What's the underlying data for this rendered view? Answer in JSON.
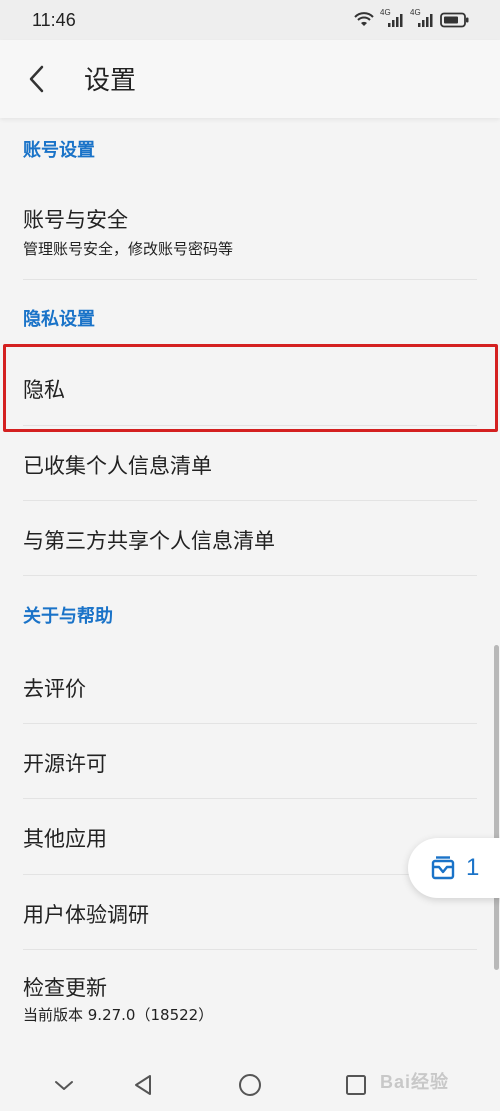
{
  "status_bar": {
    "time": "11:46",
    "signal_1_label": "4G",
    "signal_2_label": "4G"
  },
  "header": {
    "title": "设置"
  },
  "sections": {
    "account": {
      "header": "账号设置",
      "items": [
        {
          "title": "账号与安全",
          "subtitle": "管理账号安全，修改账号密码等"
        }
      ]
    },
    "privacy": {
      "header": "隐私设置",
      "items": [
        {
          "title": "隐私"
        },
        {
          "title": "已收集个人信息清单"
        },
        {
          "title": "与第三方共享个人信息清单"
        }
      ]
    },
    "about": {
      "header": "关于与帮助",
      "items": [
        {
          "title": "去评价"
        },
        {
          "title": "开源许可"
        },
        {
          "title": "其他应用"
        },
        {
          "title": "用户体验调研"
        },
        {
          "title": "检查更新",
          "subtitle": "当前版本 9.27.0（18522）"
        }
      ]
    }
  },
  "floating_button": {
    "count": "1",
    "icon": "inbox-icon"
  },
  "watermark": "Bai经验",
  "colors": {
    "accent": "#1a73c8",
    "highlight_border": "#d42020",
    "background": "#f4f4f4"
  }
}
